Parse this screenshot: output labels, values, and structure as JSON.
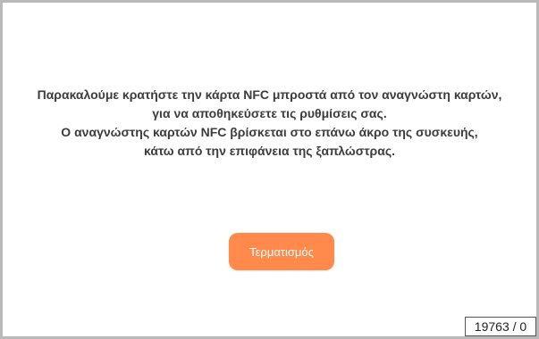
{
  "message": {
    "lines": [
      "Παρακαλούμε κρατήστε την κάρτα NFC μπροστά από τον αναγνώστη καρτών,",
      "για να αποθηκεύσετε τις ρυθμίσεις σας.",
      "Ο αναγνώστης καρτών NFC βρίσκεται στο επάνω άκρο της συσκευής,",
      "κάτω από την επιφάνεια της ξαπλώστρας."
    ]
  },
  "actions": {
    "finish_label": "Τερματισμός"
  },
  "status": {
    "counter": "19763 / 0"
  },
  "colors": {
    "accent": "#ff8a4c",
    "text": "#3c3c3c",
    "frame": "#b9b9b9"
  }
}
